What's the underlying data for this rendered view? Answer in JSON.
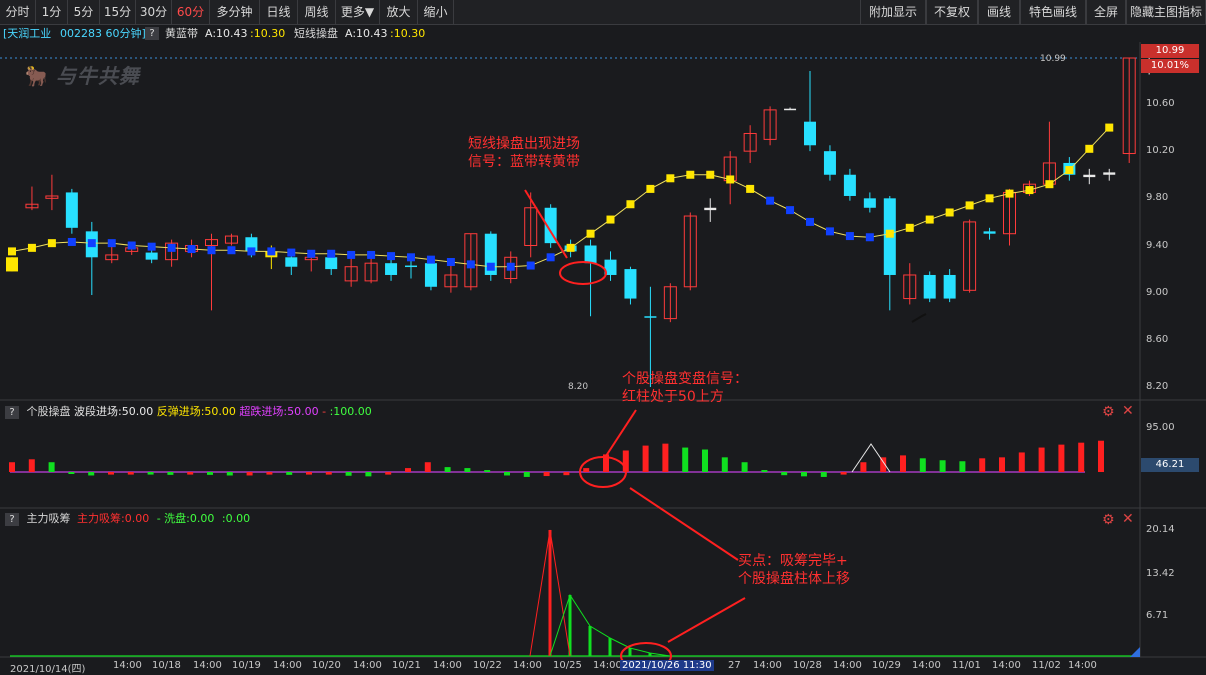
{
  "toolbar": {
    "left": [
      "分时",
      "1分",
      "5分",
      "15分",
      "30分",
      "60分",
      "多分钟",
      "日线",
      "周线",
      "更多▼",
      "放大",
      "缩小"
    ],
    "right": [
      "附加显示",
      "不复权",
      "画线",
      "特色画线",
      "全屏",
      "隐藏主图指标"
    ]
  },
  "header": {
    "stock": "[天润工业",
    "code_period": "002283 60分钟]",
    "indicator_name": "黄蓝带",
    "a_value": "A:10.43",
    "a_value2": ":10.30",
    "indicator2": "短线操盘",
    "b_value": "A:10.43",
    "b_value2": ":10.30"
  },
  "watermark": "与牛共舞",
  "price_axis": {
    "labels": [
      "10.60",
      "10.20",
      "9.80",
      "9.40",
      "9.00",
      "8.60",
      "8.20"
    ],
    "current_price": "10.99",
    "current_pct": "10.01%",
    "high_label": "10.99",
    "low_label": "8.20"
  },
  "panel2": {
    "title": "个股操盘",
    "f1": "波段进场:50.00",
    "f2": "反弹进场:50.00",
    "f3": "超跌进场:50.00",
    "f4": "-",
    "f5": ":100.00",
    "axis_top": "95.00",
    "current": "46.21"
  },
  "panel3": {
    "title": "主力吸筹",
    "f1": "主力吸筹:0.00",
    "f2": "- 洗盘:0.00",
    "f3": ":0.00",
    "axis": [
      "20.14",
      "13.42",
      "6.71"
    ]
  },
  "annotations": {
    "a1_line1": "短线操盘出现进场",
    "a1_line2": "信号：蓝带转黄带",
    "a2_line1": "个股操盘变盘信号：",
    "a2_line2": "红柱处于50上方",
    "a3_line1": "买点：吸筹完毕+",
    "a3_line2": "个股操盘柱体上移"
  },
  "x_axis": {
    "labels": [
      "2021/10/14(四)",
      "14:00",
      "10/18",
      "14:00",
      "10/19",
      "14:00",
      "10/20",
      "14:00",
      "10/21",
      "14:00",
      "10/22",
      "14:00",
      "10/25",
      "14:00",
      "10/26 11:30",
      "27",
      "14:00",
      "10/28",
      "14:00",
      "10/29",
      "14:00",
      "11/01",
      "14:00",
      "11/02",
      "14:00"
    ],
    "cursor_label": "2021/10/26 11:30"
  },
  "chart_data": {
    "type": "candlestick",
    "ylim": [
      8.1,
      11.1
    ],
    "candles": [
      {
        "o": 9.18,
        "c": 9.3,
        "h": 9.3,
        "l": 9.18,
        "k": "y"
      },
      {
        "o": 9.75,
        "c": 9.72,
        "h": 9.9,
        "l": 9.7,
        "k": "r"
      },
      {
        "o": 9.82,
        "c": 9.8,
        "h": 10.0,
        "l": 9.7,
        "k": "r"
      },
      {
        "o": 9.85,
        "c": 9.55,
        "h": 9.88,
        "l": 9.5,
        "k": "c"
      },
      {
        "o": 9.52,
        "c": 9.3,
        "h": 9.6,
        "l": 8.98,
        "k": "c"
      },
      {
        "o": 9.28,
        "c": 9.32,
        "h": 9.45,
        "l": 9.25,
        "k": "r"
      },
      {
        "o": 9.35,
        "c": 9.38,
        "h": 9.4,
        "l": 9.32,
        "k": "r"
      },
      {
        "o": 9.34,
        "c": 9.28,
        "h": 9.4,
        "l": 9.25,
        "k": "c"
      },
      {
        "o": 9.28,
        "c": 9.42,
        "h": 9.45,
        "l": 9.22,
        "k": "r"
      },
      {
        "o": 9.35,
        "c": 9.4,
        "h": 9.45,
        "l": 9.3,
        "k": "r"
      },
      {
        "o": 9.4,
        "c": 9.45,
        "h": 9.5,
        "l": 8.85,
        "k": "r"
      },
      {
        "o": 9.42,
        "c": 9.48,
        "h": 9.5,
        "l": 9.4,
        "k": "r"
      },
      {
        "o": 9.47,
        "c": 9.35,
        "h": 9.5,
        "l": 9.3,
        "k": "c"
      },
      {
        "o": 9.35,
        "c": 9.3,
        "h": 9.4,
        "l": 9.2,
        "k": "y"
      },
      {
        "o": 9.3,
        "c": 9.22,
        "h": 9.35,
        "l": 9.15,
        "k": "c"
      },
      {
        "o": 9.28,
        "c": 9.3,
        "h": 9.35,
        "l": 9.18,
        "k": "r"
      },
      {
        "o": 9.3,
        "c": 9.2,
        "h": 9.32,
        "l": 9.15,
        "k": "c"
      },
      {
        "o": 9.1,
        "c": 9.22,
        "h": 9.35,
        "l": 9.05,
        "k": "r"
      },
      {
        "o": 9.1,
        "c": 9.25,
        "h": 9.3,
        "l": 9.08,
        "k": "r"
      },
      {
        "o": 9.25,
        "c": 9.15,
        "h": 9.3,
        "l": 9.1,
        "k": "c"
      },
      {
        "o": 9.22,
        "c": 9.23,
        "h": 9.28,
        "l": 9.12,
        "k": "c"
      },
      {
        "o": 9.05,
        "c": 9.25,
        "h": 9.3,
        "l": 9.02,
        "k": "c"
      },
      {
        "o": 9.05,
        "c": 9.15,
        "h": 9.25,
        "l": 9.0,
        "k": "r"
      },
      {
        "o": 9.05,
        "c": 9.5,
        "h": 9.5,
        "l": 9.02,
        "k": "r"
      },
      {
        "o": 9.5,
        "c": 9.15,
        "h": 9.52,
        "l": 9.1,
        "k": "c"
      },
      {
        "o": 9.12,
        "c": 9.3,
        "h": 9.35,
        "l": 9.08,
        "k": "r"
      },
      {
        "o": 9.4,
        "c": 9.72,
        "h": 9.85,
        "l": 9.3,
        "k": "r"
      },
      {
        "o": 9.72,
        "c": 9.42,
        "h": 9.75,
        "l": 9.38,
        "k": "c"
      },
      {
        "o": 9.35,
        "c": 9.4,
        "h": 9.45,
        "l": 9.3,
        "k": "c"
      },
      {
        "o": 9.4,
        "c": 9.25,
        "h": 9.45,
        "l": 8.8,
        "k": "c"
      },
      {
        "o": 9.15,
        "c": 9.28,
        "h": 9.35,
        "l": 9.1,
        "k": "c"
      },
      {
        "o": 9.2,
        "c": 8.95,
        "h": 9.22,
        "l": 8.9,
        "k": "c"
      },
      {
        "o": 8.8,
        "c": 8.79,
        "h": 9.05,
        "l": 8.2,
        "k": "c"
      },
      {
        "o": 8.78,
        "c": 9.05,
        "h": 9.08,
        "l": 8.75,
        "k": "r"
      },
      {
        "o": 9.05,
        "c": 9.65,
        "h": 9.68,
        "l": 9.02,
        "k": "r"
      },
      {
        "o": 9.7,
        "c": 9.72,
        "h": 9.8,
        "l": 9.6,
        "k": "w"
      },
      {
        "o": 9.95,
        "c": 10.15,
        "h": 10.2,
        "l": 9.75,
        "k": "r"
      },
      {
        "o": 10.2,
        "c": 10.35,
        "h": 10.42,
        "l": 10.1,
        "k": "r"
      },
      {
        "o": 10.3,
        "c": 10.55,
        "h": 10.58,
        "l": 10.25,
        "k": "r"
      },
      {
        "o": 10.55,
        "c": 10.56,
        "h": 10.57,
        "l": 10.55,
        "k": "w"
      },
      {
        "o": 10.45,
        "c": 10.25,
        "h": 10.88,
        "l": 10.2,
        "k": "c"
      },
      {
        "o": 10.2,
        "c": 10.0,
        "h": 10.25,
        "l": 9.95,
        "k": "c"
      },
      {
        "o": 10.0,
        "c": 9.82,
        "h": 10.05,
        "l": 9.78,
        "k": "c"
      },
      {
        "o": 9.8,
        "c": 9.72,
        "h": 9.85,
        "l": 9.68,
        "k": "c"
      },
      {
        "o": 9.8,
        "c": 9.15,
        "h": 9.82,
        "l": 8.85,
        "k": "c"
      },
      {
        "o": 8.95,
        "c": 9.15,
        "h": 9.25,
        "l": 8.9,
        "k": "r"
      },
      {
        "o": 9.15,
        "c": 8.95,
        "h": 9.18,
        "l": 8.92,
        "k": "c"
      },
      {
        "o": 8.95,
        "c": 9.15,
        "h": 9.2,
        "l": 8.92,
        "k": "c"
      },
      {
        "o": 9.02,
        "c": 9.6,
        "h": 9.62,
        "l": 9.0,
        "k": "r"
      },
      {
        "o": 9.5,
        "c": 9.52,
        "h": 9.55,
        "l": 9.45,
        "k": "c"
      },
      {
        "o": 9.5,
        "c": 9.85,
        "h": 9.88,
        "l": 9.4,
        "k": "r"
      },
      {
        "o": 9.85,
        "c": 9.92,
        "h": 9.95,
        "l": 9.82,
        "k": "r"
      },
      {
        "o": 9.92,
        "c": 10.1,
        "h": 10.45,
        "l": 9.9,
        "k": "r"
      },
      {
        "o": 10.1,
        "c": 10.0,
        "h": 10.15,
        "l": 9.95,
        "k": "c"
      },
      {
        "o": 9.98,
        "c": 10.0,
        "h": 10.05,
        "l": 9.92,
        "k": "w"
      },
      {
        "o": 10.0,
        "c": 10.02,
        "h": 10.05,
        "l": 9.95,
        "k": "w"
      },
      {
        "o": 10.18,
        "c": 10.99,
        "h": 10.99,
        "l": 10.1,
        "k": "r"
      },
      {
        "o": 10.93,
        "c": 10.93,
        "h": 10.99,
        "l": 10.85,
        "k": "w"
      }
    ],
    "band": [
      9.35,
      9.38,
      9.42,
      9.43,
      9.42,
      9.42,
      9.4,
      9.39,
      9.38,
      9.37,
      9.36,
      9.36,
      9.35,
      9.35,
      9.34,
      9.33,
      9.33,
      9.32,
      9.32,
      9.31,
      9.3,
      9.28,
      9.26,
      9.24,
      9.22,
      9.22,
      9.23,
      9.3,
      9.38,
      9.5,
      9.62,
      9.75,
      9.88,
      9.97,
      10.0,
      10.0,
      9.96,
      9.88,
      9.78,
      9.7,
      9.6,
      9.52,
      9.48,
      9.47,
      9.5,
      9.55,
      9.62,
      9.68,
      9.74,
      9.8,
      9.84,
      9.87,
      9.92,
      10.04,
      10.22,
      10.4
    ]
  }
}
